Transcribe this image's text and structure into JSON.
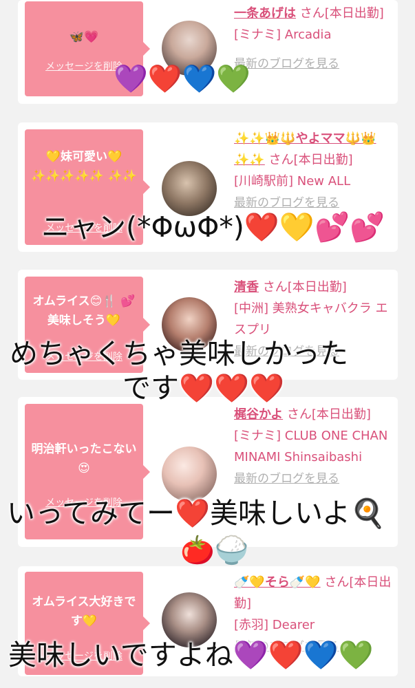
{
  "colors": {
    "accent": "#d9507a",
    "bubble": "#f6909e",
    "card": "#ffffff",
    "page": "#f2f2f2",
    "link_gray": "#b0b0b0"
  },
  "delete_label": "メッセージを削除",
  "blog_label": "最新のブログを見る",
  "cards": [
    {
      "message": "🦋💗",
      "name": "一条あげは",
      "suffix": " さん[本日出勤]",
      "shop": "[ミナミ] Arcadia"
    },
    {
      "message": "💛妹可愛い💛 ✨✨✨✨✨ ✨✨",
      "name": "✨✨👑🔱やよママ🔱👑✨✨",
      "suffix": " さん[本日出勤]",
      "shop": "[川崎駅前] New ALL"
    },
    {
      "message": "オムライス😊🍴 💕 美味しそう💛",
      "name": "清香",
      "suffix": " さん[本日出勤]",
      "shop": "[中洲] 美熟女キャバクラ エスプリ"
    },
    {
      "message": "明治軒いったこない😍",
      "name": "梶谷かよ",
      "suffix": " さん[本日出勤]",
      "shop": "[ミナミ] CLUB ONE CHAN MINAMI Shinsaibashi"
    },
    {
      "message": "オムライス大好きです💛",
      "name": "🍼💛そら🍼💛",
      "suffix": " さん[本日出勤]",
      "shop": "[赤羽] Dearer"
    }
  ],
  "overlays": {
    "hearts1": "💜❤️💙💚",
    "text2": "ニャン(*ΦωΦ*)❤️💛💕💕",
    "text3a": "めちゃくちゃ美味しかった",
    "text3b": "です❤️❤️❤️",
    "text4": "いってみてー❤️美味しいよ🍳",
    "food4": "🍅🍚",
    "text5": "美味しいですよね💜❤️💙💚"
  }
}
